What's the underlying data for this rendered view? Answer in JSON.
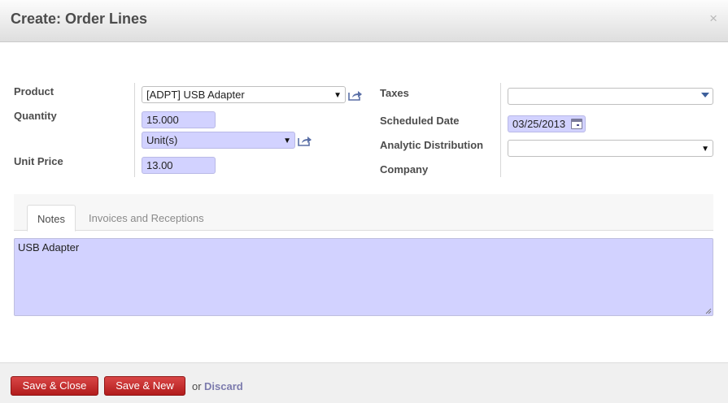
{
  "dialog": {
    "title": "Create: Order Lines",
    "close_glyph": "×"
  },
  "form": {
    "product": {
      "label": "Product",
      "value": "[ADPT] USB Adapter"
    },
    "quantity": {
      "label": "Quantity",
      "value": "15.000",
      "uom": "Unit(s)"
    },
    "unit_price": {
      "label": "Unit Price",
      "value": "13.00"
    },
    "taxes": {
      "label": "Taxes",
      "value": ""
    },
    "scheduled_date": {
      "label": "Scheduled Date",
      "value": "03/25/2013"
    },
    "analytic_distribution": {
      "label": "Analytic Distribution",
      "value": ""
    },
    "company": {
      "label": "Company",
      "value": ""
    }
  },
  "tabs": [
    {
      "label": "Notes",
      "active": true
    },
    {
      "label": "Invoices and Receptions",
      "active": false
    }
  ],
  "notes": {
    "value": "USB Adapter"
  },
  "footer": {
    "save_close": "Save & Close",
    "save_new": "Save & New",
    "or": "or",
    "discard": "Discard"
  },
  "colors": {
    "required_field_bg": "#d2d2ff",
    "button_red": "#c62828",
    "link": "#7c7bad"
  },
  "icons": {
    "external_link": "external-link-icon",
    "calendar": "calendar-icon",
    "dropdown": "dropdown-arrow-icon",
    "close": "close-icon",
    "resize": "resize-grip-icon"
  }
}
